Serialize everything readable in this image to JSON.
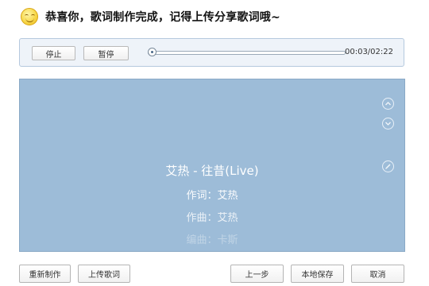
{
  "header": {
    "title": "恭喜你，歌词制作完成，记得上传分享歌词哦~"
  },
  "player": {
    "stop_label": "停止",
    "pause_label": "暂停",
    "time": "00:03/02:22",
    "progress_fraction": 0.021
  },
  "preview": {
    "lines": [
      "艾热 - 往昔(Live)",
      "作词：艾热",
      "作曲：艾热",
      "编曲：卡斯"
    ]
  },
  "footer": {
    "remake_label": "重新制作",
    "upload_label": "上传歌词",
    "prev_label": "上一步",
    "save_label": "本地保存",
    "cancel_label": "取消"
  },
  "colors": {
    "preview_bg": "#9dbcd8",
    "player_bg": "#eef3f9",
    "accent": "#7fa9d4"
  }
}
